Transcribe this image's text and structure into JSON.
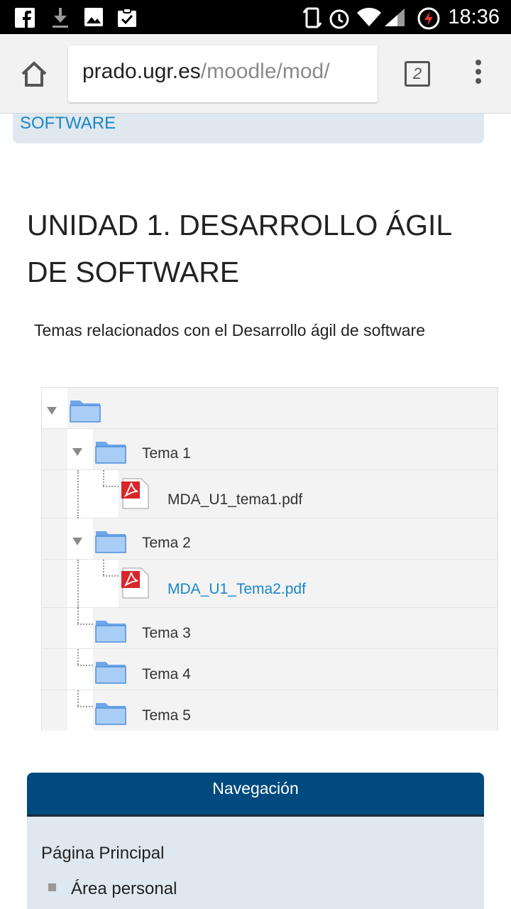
{
  "status_bar": {
    "time": "18:36",
    "icons": [
      "facebook-icon",
      "download-icon",
      "image-icon",
      "clipboard-check-icon",
      "rotate-icon",
      "alarm-icon",
      "wifi-icon",
      "signal-icon",
      "battery-charging-icon"
    ]
  },
  "browser": {
    "url_host": "prado.ugr.es",
    "url_path": "/moodle/mod/",
    "tab_count": "2"
  },
  "top_banner": {
    "link_text": "SOFTWARE"
  },
  "section": {
    "title": "UNIDAD 1. DESARROLLO ÁGIL DE SOFTWARE",
    "summary": "Temas relacionados con el Desarrollo ágil de software"
  },
  "tree": {
    "root_label": "",
    "items": [
      {
        "label": "Tema 1",
        "type": "folder",
        "expanded": true
      },
      {
        "label": "MDA_U1_tema1.pdf",
        "type": "pdf"
      },
      {
        "label": "Tema 2",
        "type": "folder",
        "expanded": true
      },
      {
        "label": "MDA_U1_Tema2.pdf",
        "type": "pdf"
      },
      {
        "label": "Tema 3",
        "type": "folder"
      },
      {
        "label": "Tema 4",
        "type": "folder"
      },
      {
        "label": "Tema 5",
        "type": "folder"
      }
    ]
  },
  "navigation": {
    "header": "Navegación",
    "home": "Página Principal",
    "items": [
      "Área personal"
    ]
  },
  "colors": {
    "link": "#1a87c7",
    "nav_header_bg": "#004a7f",
    "banner_bg": "#dfe8ee"
  }
}
